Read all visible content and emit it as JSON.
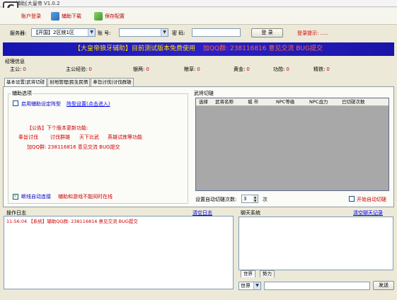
{
  "window": {
    "title": "辅助[大皇帝 V1.0.2"
  },
  "toolbar": {
    "login_label": "账户登录",
    "download_label": "辅助下载",
    "save_config_label": "保存配置"
  },
  "server_bar": {
    "server_label": "服务器:",
    "server_value": "【开国】2区统1区",
    "account_label": "账 号:",
    "account_value": "",
    "password_label": "密 码:",
    "password_value": "",
    "login_button": "登 录",
    "login_hint": "登录提示: ....."
  },
  "banner": {
    "text": "【大皇帝狼牙辅助】目前测试版本免费使用",
    "qq_text": "加QQ群: 238116816 意见交流 BUG提交"
  },
  "stats": {
    "title": "经理信息",
    "items": [
      {
        "label": "主公:",
        "value": "0"
      },
      {
        "label": "主公经验:",
        "value": "0"
      },
      {
        "label": "银两:",
        "value": "0"
      },
      {
        "label": "粮草:",
        "value": "0"
      },
      {
        "label": "黄金:",
        "value": "0"
      },
      {
        "label": "功勋:",
        "value": "0"
      },
      {
        "label": "精铁:",
        "value": "0"
      }
    ]
  },
  "tabs": [
    {
      "label": "基本设置|武将切磋"
    },
    {
      "label": "封地管理|民生民情"
    },
    {
      "label": "奉旨讨伐|讨伐群雄"
    }
  ],
  "assist": {
    "group_title": "辅助选项",
    "enable_label": "启用辅助设定阵型",
    "formation_link": "阵型设置(点击进入)",
    "announce_title": "【公告】下个版本更新功能:",
    "announce_line1": [
      "奉旨讨伐",
      "讨伐群雄",
      "天下比武",
      "英雄试炼等功能"
    ],
    "announce_line2": "加QQ群: 238116816 意见交流 BUG提交",
    "auto_connect_label": "断线自动连接",
    "auto_connect_note": "辅助和游戏不能同时在线"
  },
  "duel": {
    "group_title": "武将切磋",
    "columns": [
      "选择",
      "武将名称",
      "城 市",
      "NPC等级",
      "NPC战力",
      "已切磋次数"
    ],
    "count_label": "设置自动切磋次数:",
    "count_value": "3",
    "count_unit": "次",
    "auto_duel_label": "开始自动切磋"
  },
  "log": {
    "title": "操作日志",
    "clear_label": "清空日志",
    "lines": [
      {
        "time": "11:56:04",
        "text": "【系统】辅助QQ群: 238116816 意见交流 BUG提交"
      }
    ]
  },
  "chat": {
    "title": "聊天系统",
    "clear_label": "清空聊天记录",
    "tabs": [
      "世界",
      "势力"
    ],
    "channel_value": "世界",
    "message_value": "",
    "send_label": "发送"
  },
  "colors": {
    "banner_bg": "#1a18b0",
    "banner_text": "#ffde00",
    "accent_red": "#d00000",
    "link_blue": "#0000ee"
  }
}
